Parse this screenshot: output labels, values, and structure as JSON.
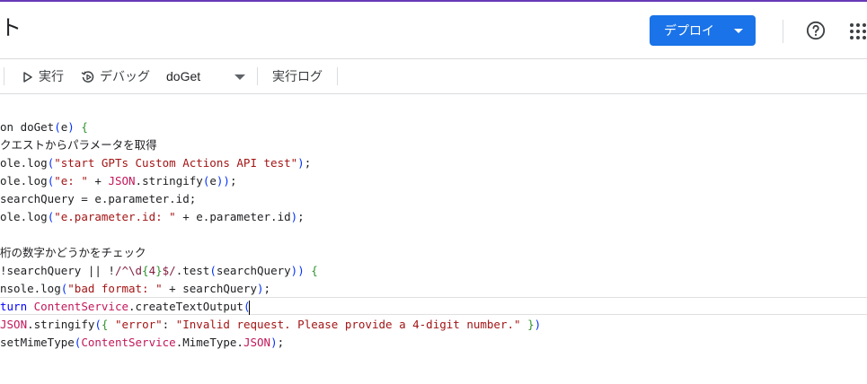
{
  "header": {
    "title_fragment": "ト",
    "deploy_label": "デプロイ",
    "help_icon": "help-circle-icon",
    "apps_icon": "apps-grid-icon",
    "accent_color": "#673ab7",
    "deploy_color": "#1a73e8"
  },
  "toolbar": {
    "run_label": "実行",
    "debug_label": "デバッグ",
    "function_selected": "doGet",
    "log_label": "実行ログ"
  },
  "editor": {
    "lines": [
      "on doGet(e) {",
      "クエストからパラメータを取得",
      "ole.log(\"start GPTs Custom Actions API test\");",
      "ole.log(\"e: \" + JSON.stringify(e));",
      "searchQuery = e.parameter.id;",
      "ole.log(\"e.parameter.id: \" + e.parameter.id);",
      "",
      "桁の数字かどうかをチェック",
      "!searchQuery || !/^\\d{4}$/.test(searchQuery)) {",
      "nsole.log(\"bad format: \" + searchQuery);",
      "turn ContentService.createTextOutput(",
      "JSON.stringify({ \"error\": \"Invalid request. Please provide a 4-digit number.\" })",
      "setMimeType(ContentService.MimeType.JSON);"
    ]
  }
}
